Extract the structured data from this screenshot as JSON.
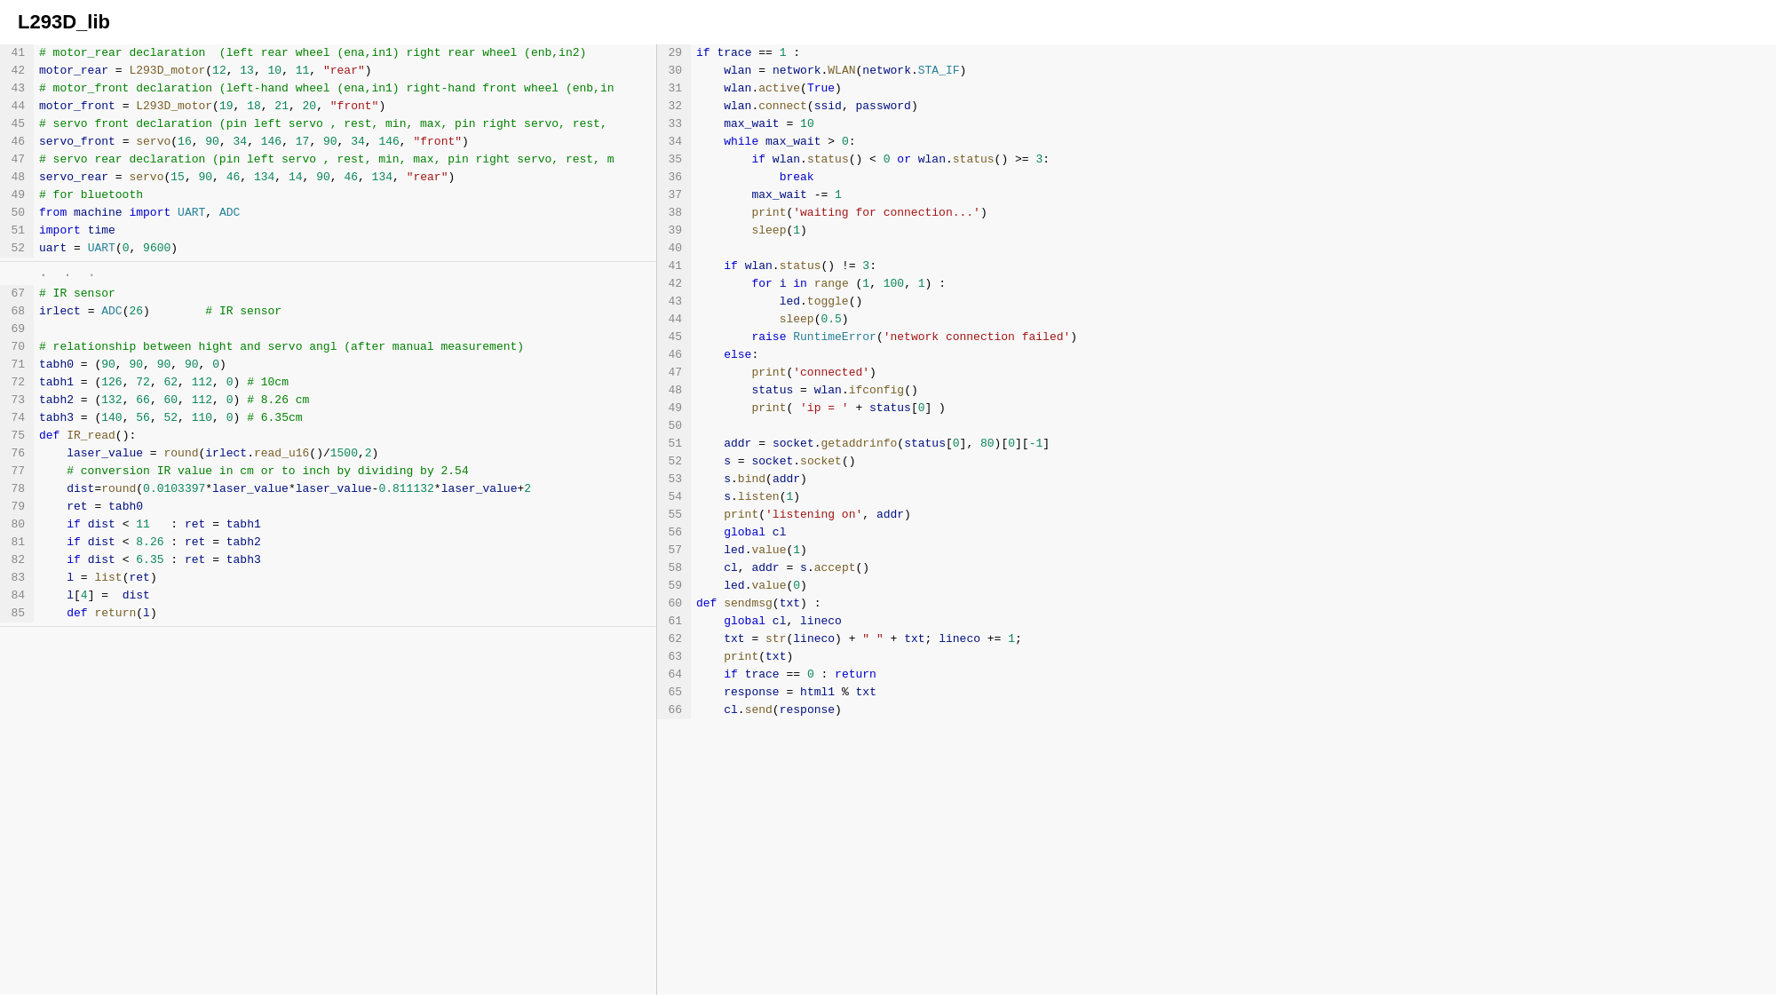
{
  "title": "L293D_lib",
  "left_panel": {
    "sections": [
      {
        "lines": [
          {
            "num": 41,
            "content": "# motor_rear declaration  (left rear wheel (ena,in1) right rear wheel (enb,in2)"
          },
          {
            "num": 42,
            "content": "motor_rear = L293D_motor(12, 13, 10, 11, \"rear\")"
          },
          {
            "num": 43,
            "content": "# motor_front declaration (left-hand wheel (ena,in1) right-hand front wheel (enb,in"
          },
          {
            "num": 44,
            "content": "motor_front = L293D_motor(19, 18, 21, 20, \"front\")"
          },
          {
            "num": 45,
            "content": "# servo front declaration (pin left servo , rest, min, max, pin right servo, rest,"
          },
          {
            "num": 46,
            "content": "servo_front = servo(16, 90, 34, 146, 17, 90, 34, 146, \"front\")"
          },
          {
            "num": 47,
            "content": "# servo rear declaration (pin left servo , rest, min, max, pin right servo, rest, m"
          },
          {
            "num": 48,
            "content": "servo_rear = servo(15, 90, 46, 134, 14, 90, 46, 134, \"rear\")"
          },
          {
            "num": 49,
            "content": "# for bluetooth"
          },
          {
            "num": 50,
            "content": "from machine import UART, ADC"
          },
          {
            "num": 51,
            "content": "import time"
          },
          {
            "num": 52,
            "content": "uart = UART(0, 9600)"
          }
        ]
      },
      {
        "dots": true
      },
      {
        "lines": [
          {
            "num": 67,
            "content": "# IR sensor"
          },
          {
            "num": 68,
            "content": "irlect = ADC(26)        # IR sensor"
          },
          {
            "num": 69,
            "content": ""
          },
          {
            "num": 70,
            "content": "# relationship between hight and servo angl (after manual measurement)"
          },
          {
            "num": 71,
            "content": "tabh0 = (90, 90, 90, 90, 0)"
          },
          {
            "num": 72,
            "content": "tabh1 = (126, 72, 62, 112, 0) # 10cm"
          },
          {
            "num": 73,
            "content": "tabh2 = (132, 66, 60, 112, 0) # 8.26 cm"
          },
          {
            "num": 74,
            "content": "tabh3 = (140, 56, 52, 110, 0) # 6.35cm"
          },
          {
            "num": 75,
            "content": "def IR_read():"
          },
          {
            "num": 76,
            "content": "    laser_value = round(irlect.read_u16()/1500,2)"
          },
          {
            "num": 77,
            "content": "    # conversion IR value in cm or to inch by dividing by 2.54"
          },
          {
            "num": 78,
            "content": "    dist=round(0.0103397*laser_value*laser_value-0.811132*laser_value+2"
          },
          {
            "num": 79,
            "content": "    ret = tabh0"
          },
          {
            "num": 80,
            "content": "    if dist < 11   : ret = tabh1"
          },
          {
            "num": 81,
            "content": "    if dist < 8.26 : ret = tabh2"
          },
          {
            "num": 82,
            "content": "    if dist < 6.35 : ret = tabh3"
          },
          {
            "num": 83,
            "content": "    l = list(ret)"
          },
          {
            "num": 84,
            "content": "    l[4] =  dist"
          },
          {
            "num": 85,
            "content": "    def return(l)"
          }
        ]
      }
    ]
  },
  "right_panel": {
    "lines": [
      {
        "num": 29,
        "content": "if trace == 1 :"
      },
      {
        "num": 30,
        "content": "    wlan = network.WLAN(network.STA_IF)"
      },
      {
        "num": 31,
        "content": "    wlan.active(True)"
      },
      {
        "num": 32,
        "content": "    wlan.connect(ssid, password)"
      },
      {
        "num": 33,
        "content": "    max_wait = 10"
      },
      {
        "num": 34,
        "content": "    while max_wait > 0:"
      },
      {
        "num": 35,
        "content": "        if wlan.status() < 0 or wlan.status() >= 3:"
      },
      {
        "num": 36,
        "content": "            break"
      },
      {
        "num": 37,
        "content": "        max_wait -= 1"
      },
      {
        "num": 38,
        "content": "        print('waiting for connection...')"
      },
      {
        "num": 39,
        "content": "        sleep(1)"
      },
      {
        "num": 40,
        "content": ""
      },
      {
        "num": 41,
        "content": "    if wlan.status() != 3:"
      },
      {
        "num": 42,
        "content": "        for i in range (1, 100, 1) :"
      },
      {
        "num": 43,
        "content": "            led.toggle()"
      },
      {
        "num": 44,
        "content": "            sleep(0.5)"
      },
      {
        "num": 45,
        "content": "        raise RuntimeError('network connection failed')"
      },
      {
        "num": 46,
        "content": "    else:"
      },
      {
        "num": 47,
        "content": "        print('connected')"
      },
      {
        "num": 48,
        "content": "        status = wlan.ifconfig()"
      },
      {
        "num": 49,
        "content": "        print( 'ip = ' + status[0] )"
      },
      {
        "num": 50,
        "content": ""
      },
      {
        "num": 51,
        "content": "    addr = socket.getaddrinfo(status[0], 80)[0][-1]"
      },
      {
        "num": 52,
        "content": "    s = socket.socket()"
      },
      {
        "num": 53,
        "content": "    s.bind(addr)"
      },
      {
        "num": 54,
        "content": "    s.listen(1)"
      },
      {
        "num": 55,
        "content": "    print('listening on', addr)"
      },
      {
        "num": 56,
        "content": "    global cl"
      },
      {
        "num": 57,
        "content": "    led.value(1)"
      },
      {
        "num": 58,
        "content": "    cl, addr = s.accept()"
      },
      {
        "num": 59,
        "content": "    led.value(0)"
      },
      {
        "num": 60,
        "content": "def sendmsg(txt) :"
      },
      {
        "num": 61,
        "content": "    global cl, lineco"
      },
      {
        "num": 62,
        "content": "    txt = str(lineco) + \" \" + txt; lineco += 1;"
      },
      {
        "num": 63,
        "content": "    print(txt)"
      },
      {
        "num": 64,
        "content": "    if trace == 0 : return"
      },
      {
        "num": 65,
        "content": "    response = html1 % txt"
      },
      {
        "num": 66,
        "content": "    cl.send(response)"
      }
    ]
  }
}
